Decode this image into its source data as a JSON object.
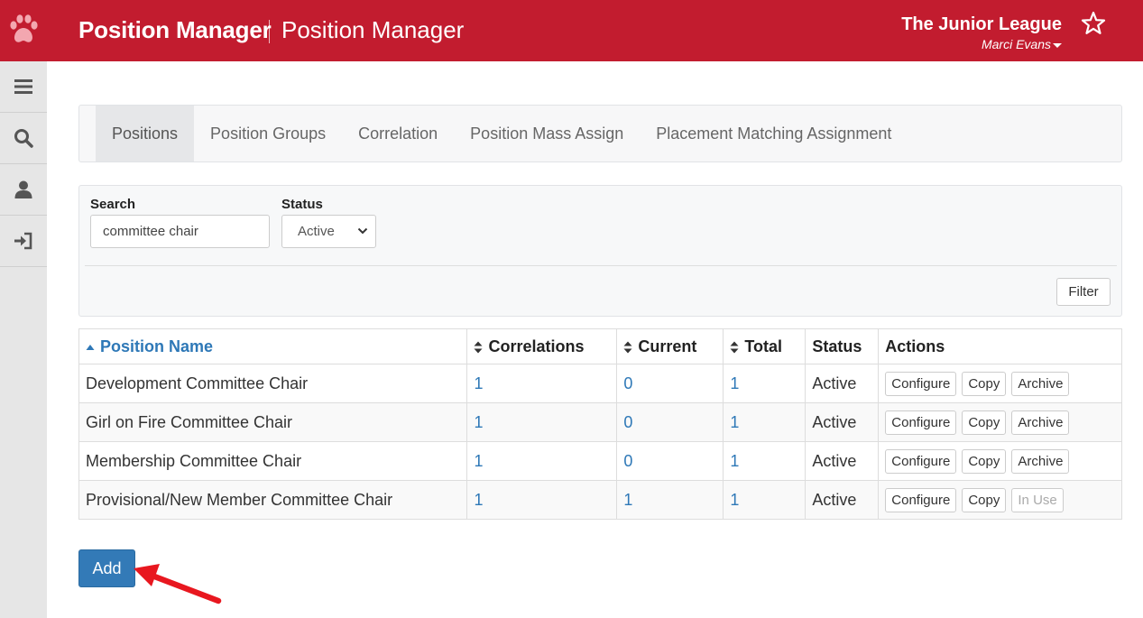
{
  "header": {
    "app_title": "Position Manager",
    "app_subtitle": "Position Manager",
    "org_name": "The Junior League",
    "user_name": "Marci Evans"
  },
  "sidebar": {
    "items": [
      {
        "icon": "menu-icon"
      },
      {
        "icon": "search-icon"
      },
      {
        "icon": "user-icon"
      },
      {
        "icon": "logout-icon"
      }
    ]
  },
  "tabs": [
    {
      "label": "Positions",
      "active": true
    },
    {
      "label": "Position Groups"
    },
    {
      "label": "Correlation"
    },
    {
      "label": "Position Mass Assign"
    },
    {
      "label": "Placement Matching Assignment"
    }
  ],
  "filters": {
    "search_label": "Search",
    "search_value": "committee chair",
    "status_label": "Status",
    "status_value": "Active",
    "filter_button": "Filter"
  },
  "table": {
    "headers": {
      "name": "Position Name",
      "correlations": "Correlations",
      "current": "Current",
      "total": "Total",
      "status": "Status",
      "actions": "Actions"
    },
    "rows": [
      {
        "name": "Development Committee Chair",
        "correlations": "1",
        "current": "0",
        "total": "1",
        "status": "Active",
        "configure": "Configure",
        "copy": "Copy",
        "third": "Archive"
      },
      {
        "name": "Girl on Fire Committee Chair",
        "correlations": "1",
        "current": "0",
        "total": "1",
        "status": "Active",
        "configure": "Configure",
        "copy": "Copy",
        "third": "Archive"
      },
      {
        "name": "Membership Committee Chair",
        "correlations": "1",
        "current": "0",
        "total": "1",
        "status": "Active",
        "configure": "Configure",
        "copy": "Copy",
        "third": "Archive"
      },
      {
        "name": "Provisional/New Member Committee Chair",
        "correlations": "1",
        "current": "1",
        "total": "1",
        "status": "Active",
        "configure": "Configure",
        "copy": "Copy",
        "third": "In Use"
      }
    ]
  },
  "add_button": "Add",
  "colors": {
    "brand_red": "#c21c2f",
    "link_blue": "#2e78b7",
    "primary_button": "#337ab7",
    "annotation_arrow": "#e8171f"
  }
}
